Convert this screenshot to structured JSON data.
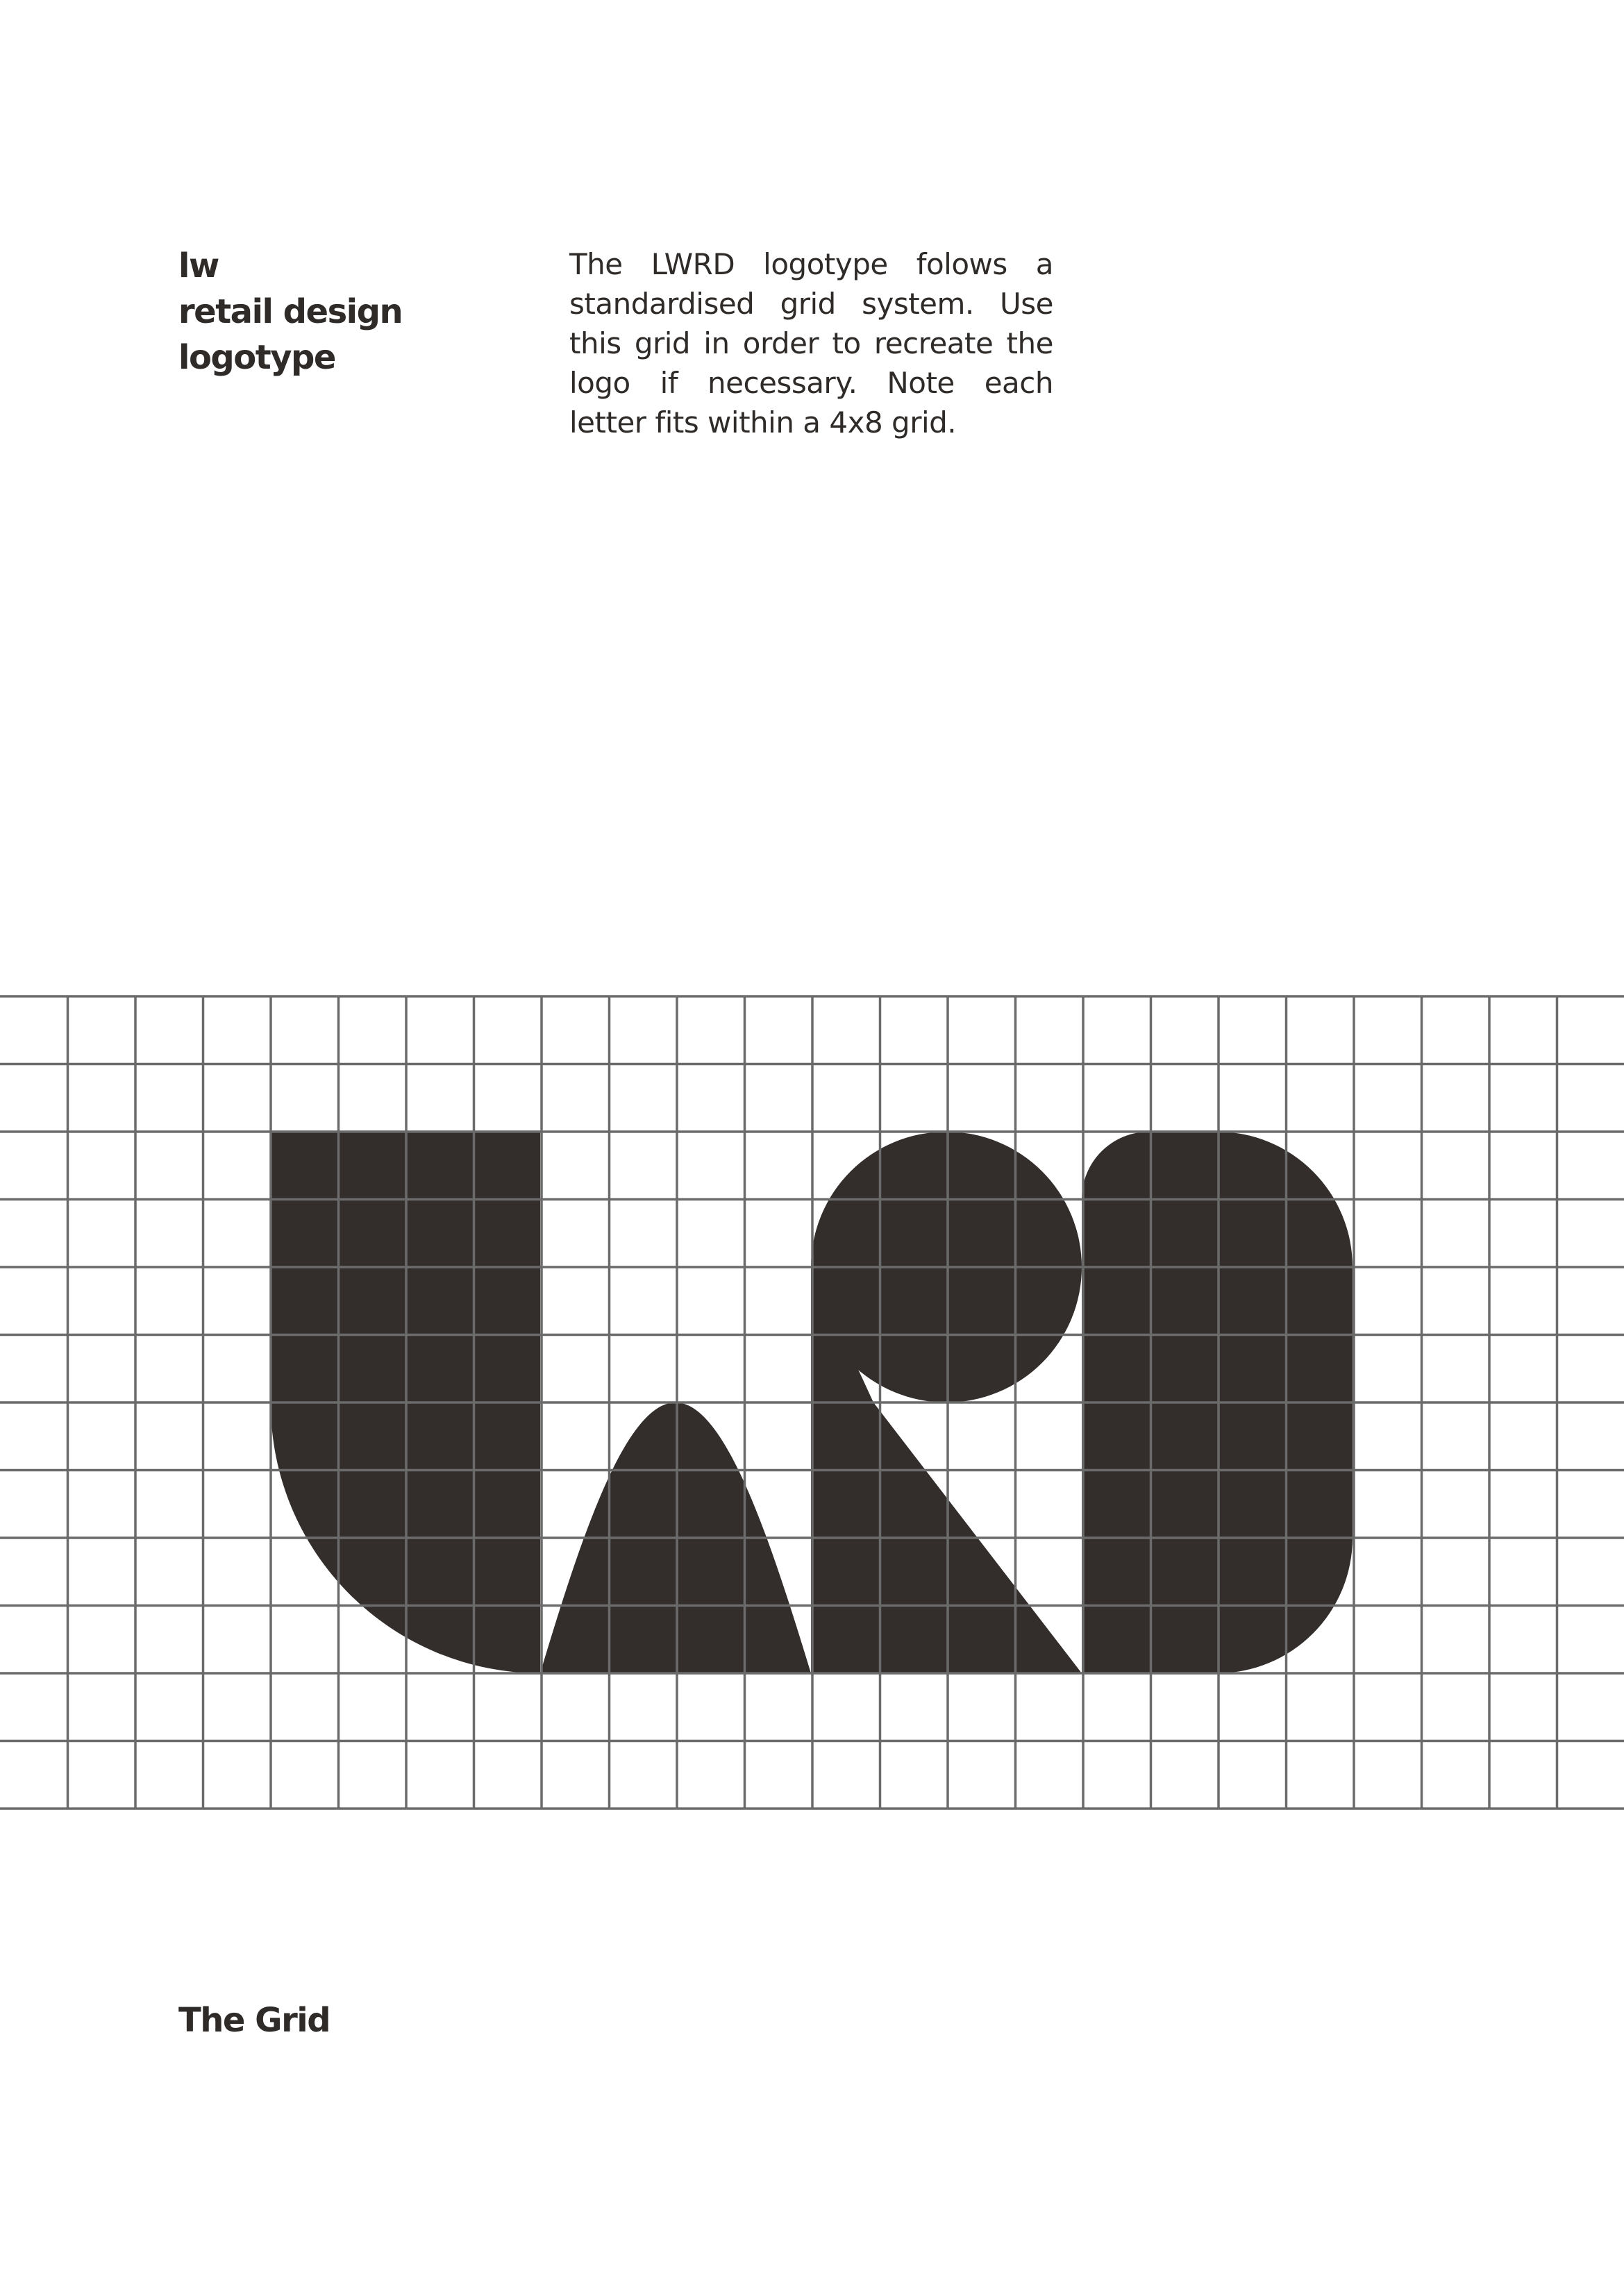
{
  "header": {
    "lines": [
      "lw",
      "retail design",
      "logotype"
    ]
  },
  "intro": {
    "text": "The LWRD logotype folows a standardised grid system. Use this grid in order to recreate the logo if necessary. Note each letter fits within a 4x8 grid."
  },
  "figure": {
    "grid_columns_per_letter": 4,
    "grid_rows_per_letter": 8,
    "letters": [
      "L",
      "W",
      "R",
      "D"
    ],
    "ink_color": "#332e2c",
    "grid_line_color": "#6b6b6b"
  },
  "footer": {
    "title": "The Grid"
  }
}
